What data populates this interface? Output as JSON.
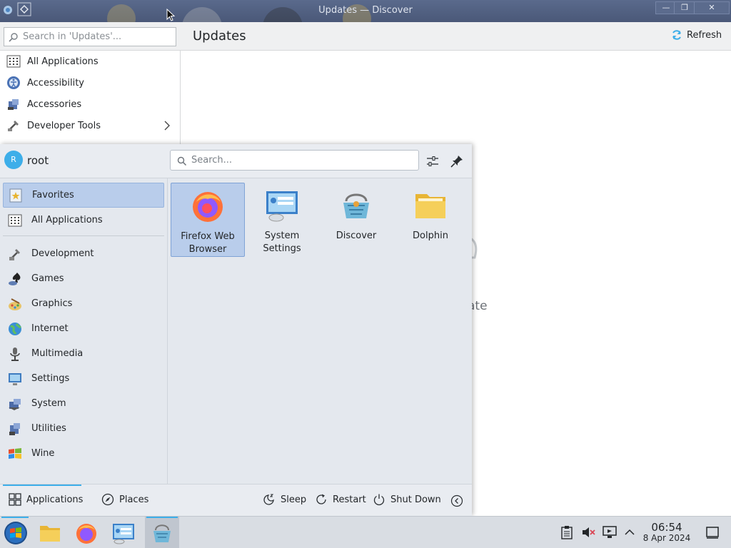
{
  "window": {
    "title": "Updates — Discover",
    "minimize_glyph": "—",
    "maximize_glyph": "❐",
    "close_glyph": "✕"
  },
  "discover": {
    "search_placeholder": "Search in 'Updates'...",
    "page_title": "Updates",
    "refresh_label": "Refresh",
    "categories": [
      {
        "label": "All Applications",
        "icon": "grid-icon"
      },
      {
        "label": "Accessibility",
        "icon": "accessibility-icon"
      },
      {
        "label": "Accessories",
        "icon": "accessories-icon"
      },
      {
        "label": "Developer Tools",
        "icon": "developer-tools-icon",
        "has_submenu": true
      }
    ],
    "background_text": "ate"
  },
  "launcher": {
    "user": {
      "initial": "R",
      "name": "root"
    },
    "search_placeholder": "Search...",
    "sidebar": [
      {
        "label": "Favorites",
        "icon": "favorites-icon",
        "selected": true
      },
      {
        "label": "All Applications",
        "icon": "grid-icon"
      },
      {
        "label": "Development",
        "icon": "development-icon"
      },
      {
        "label": "Games",
        "icon": "games-icon"
      },
      {
        "label": "Graphics",
        "icon": "graphics-icon"
      },
      {
        "label": "Internet",
        "icon": "internet-icon"
      },
      {
        "label": "Multimedia",
        "icon": "multimedia-icon"
      },
      {
        "label": "Settings",
        "icon": "settings-icon"
      },
      {
        "label": "System",
        "icon": "system-icon"
      },
      {
        "label": "Utilities",
        "icon": "utilities-icon"
      },
      {
        "label": "Wine",
        "icon": "wine-icon"
      }
    ],
    "favorites": [
      {
        "label": "Firefox Web Browser",
        "icon": "firefox-icon",
        "selected": true
      },
      {
        "label": "System Settings",
        "icon": "system-settings-icon"
      },
      {
        "label": "Discover",
        "icon": "discover-icon"
      },
      {
        "label": "Dolphin",
        "icon": "dolphin-folder-icon"
      }
    ],
    "footer": {
      "applications": "Applications",
      "places": "Places",
      "sleep": "Sleep",
      "restart": "Restart",
      "shutdown": "Shut Down"
    }
  },
  "taskbar": {
    "clock_time": "06:54",
    "clock_date": "8 Apr 2024"
  },
  "colors": {
    "accent": "#3daee9",
    "selection": "#b9cdeb",
    "titlebar": "#4a5878"
  }
}
